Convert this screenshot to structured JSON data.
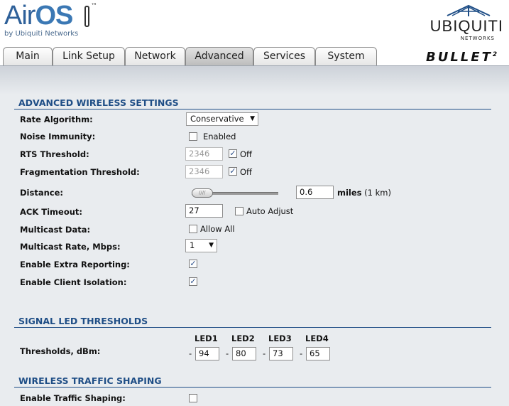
{
  "header": {
    "product_air": "Air",
    "product_os": "OS",
    "tm": "™",
    "byline": "by Ubiquiti Networks",
    "brand": "UBIQUITI",
    "brand_sub": "NETWORKS",
    "device": "BULLET",
    "device_sup": "2"
  },
  "tabs": [
    {
      "label": "Main",
      "active": false
    },
    {
      "label": "Link Setup",
      "active": false
    },
    {
      "label": "Network",
      "active": false
    },
    {
      "label": "Advanced",
      "active": true
    },
    {
      "label": "Services",
      "active": false
    },
    {
      "label": "System",
      "active": false
    }
  ],
  "advanced": {
    "title": "ADVANCED WIRELESS SETTINGS",
    "rate_algorithm": {
      "label": "Rate Algorithm:",
      "value": "Conservative"
    },
    "noise_immunity": {
      "label": "Noise Immunity:",
      "checkbox_label": "Enabled",
      "checked": false
    },
    "rts_threshold": {
      "label": "RTS Threshold:",
      "value": "2346",
      "off_label": "Off",
      "off_checked": true
    },
    "frag_threshold": {
      "label": "Fragmentation Threshold:",
      "value": "2346",
      "off_label": "Off",
      "off_checked": true
    },
    "distance": {
      "label": "Distance:",
      "value": "0.6",
      "unit_bold": "miles",
      "unit_rest": "(1 km)",
      "slider_fraction": 0.03
    },
    "ack_timeout": {
      "label": "ACK Timeout:",
      "value": "27",
      "auto_label": "Auto Adjust",
      "auto_checked": false
    },
    "multicast_data": {
      "label": "Multicast Data:",
      "checkbox_label": "Allow All",
      "checked": false
    },
    "multicast_rate": {
      "label": "Multicast Rate, Mbps:",
      "value": "1"
    },
    "extra_reporting": {
      "label": "Enable Extra Reporting:",
      "checked": true
    },
    "client_isolation": {
      "label": "Enable Client Isolation:",
      "checked": true
    }
  },
  "led": {
    "title": "SIGNAL LED THRESHOLDS",
    "label": "Thresholds, dBm:",
    "headers": [
      "LED1",
      "LED2",
      "LED3",
      "LED4"
    ],
    "values": [
      "94",
      "80",
      "73",
      "65"
    ],
    "dash": "-"
  },
  "shaping": {
    "title": "WIRELESS TRAFFIC SHAPING",
    "enable_label": "Enable Traffic Shaping:",
    "checked": false
  },
  "colors": {
    "section_text": "#1f4e86",
    "panel_bg": "#e9ebee"
  },
  "checkmark": "✓"
}
